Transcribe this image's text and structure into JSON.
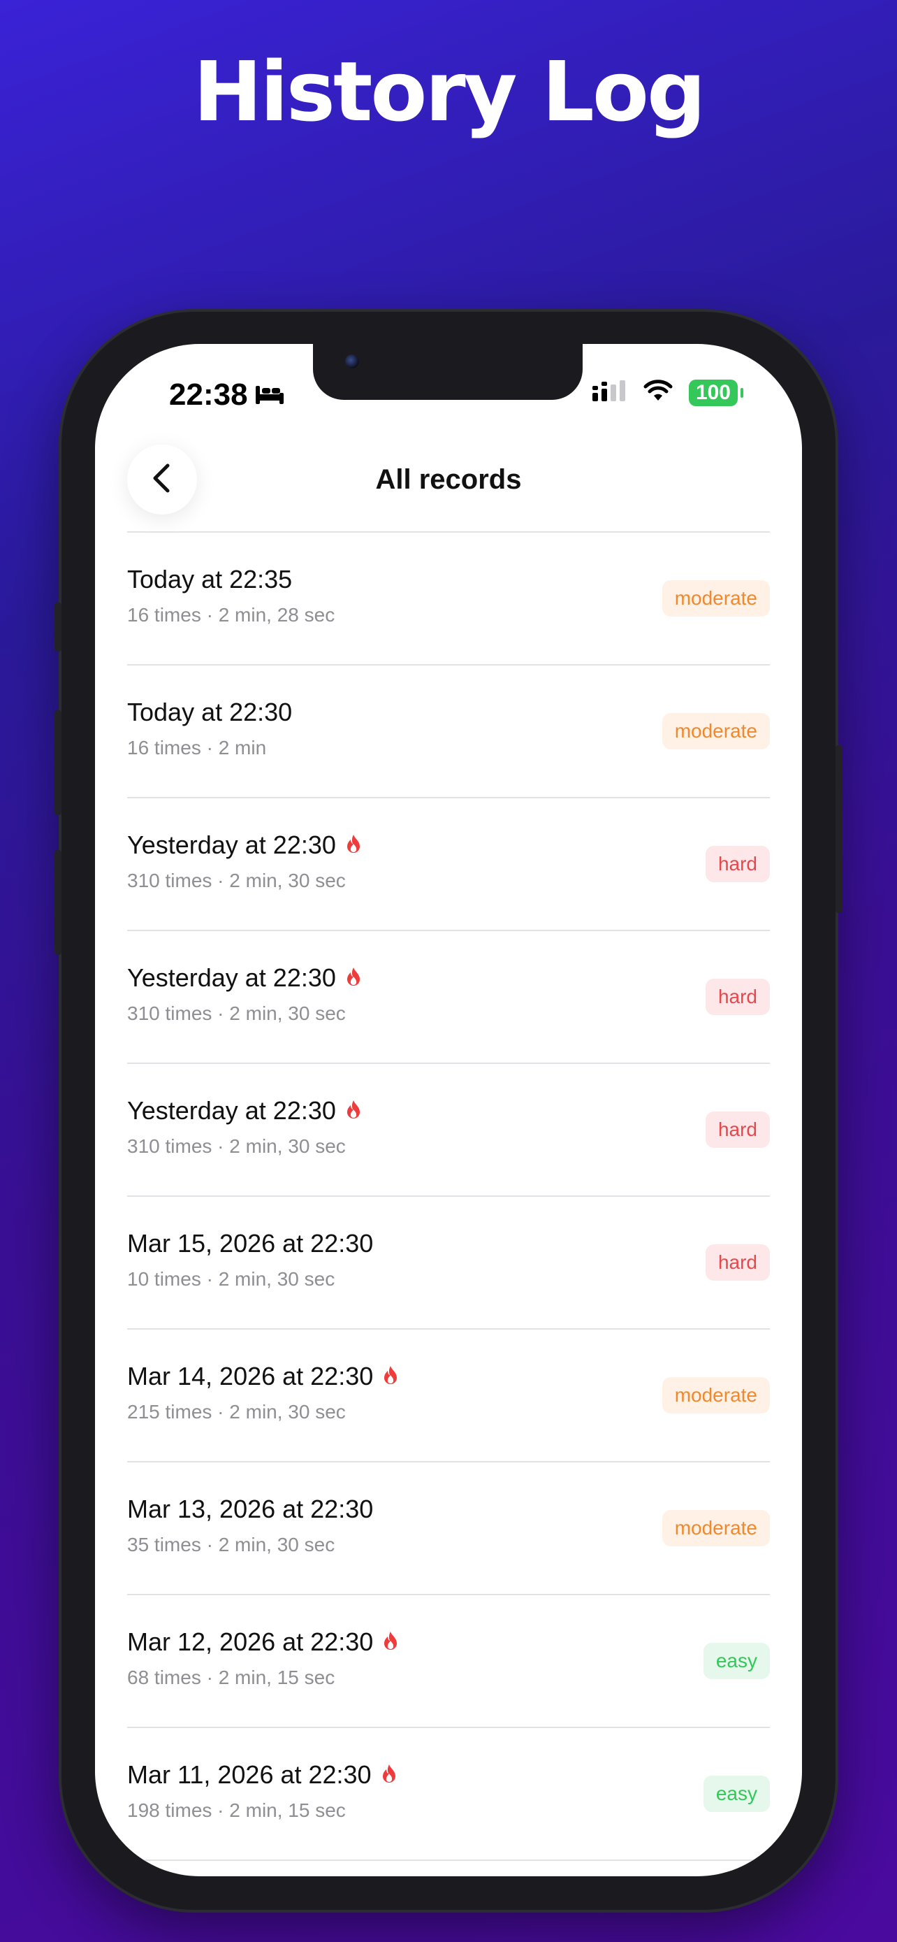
{
  "promo": {
    "title": "History Log"
  },
  "status_bar": {
    "time": "22:38",
    "battery": "100"
  },
  "nav": {
    "title": "All records"
  },
  "records": [
    {
      "title": "Today at 22:35",
      "subtitle": "16 times · 2 min, 28 sec",
      "difficulty": "moderate",
      "streak": false
    },
    {
      "title": "Today at 22:30",
      "subtitle": "16 times · 2 min",
      "difficulty": "moderate",
      "streak": false
    },
    {
      "title": "Yesterday at 22:30",
      "subtitle": "310 times · 2 min, 30 sec",
      "difficulty": "hard",
      "streak": true
    },
    {
      "title": "Yesterday at 22:30",
      "subtitle": "310 times · 2 min, 30 sec",
      "difficulty": "hard",
      "streak": true
    },
    {
      "title": "Yesterday at 22:30",
      "subtitle": "310 times · 2 min, 30 sec",
      "difficulty": "hard",
      "streak": true
    },
    {
      "title": "Mar 15, 2026 at 22:30",
      "subtitle": "10 times · 2 min, 30 sec",
      "difficulty": "hard",
      "streak": false
    },
    {
      "title": "Mar 14, 2026 at 22:30",
      "subtitle": "215 times · 2 min, 30 sec",
      "difficulty": "moderate",
      "streak": true
    },
    {
      "title": "Mar 13, 2026 at 22:30",
      "subtitle": "35 times · 2 min, 30 sec",
      "difficulty": "moderate",
      "streak": false
    },
    {
      "title": "Mar 12, 2026 at 22:30",
      "subtitle": "68 times · 2 min, 15 sec",
      "difficulty": "easy",
      "streak": true
    },
    {
      "title": "Mar 11, 2026 at 22:30",
      "subtitle": "198 times · 2 min, 15 sec",
      "difficulty": "easy",
      "streak": true
    }
  ],
  "colors": {
    "moderate": "#f0892d",
    "hard": "#e5484d",
    "easy": "#34c759",
    "streak_flame": "#ef3b3b",
    "battery": "#34c759"
  }
}
